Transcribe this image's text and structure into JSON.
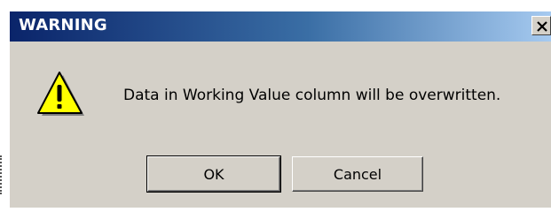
{
  "dialog": {
    "title": "WARNING",
    "message": "Data in Working Value column will be overwritten.",
    "icon": "warning-icon",
    "close_icon": "close-icon",
    "buttons": {
      "ok_label": "OK",
      "cancel_label": "Cancel"
    },
    "colors": {
      "titlebar_start": "#0a246a",
      "titlebar_end": "#a6caf0",
      "dialog_bg": "#d4d0c8",
      "warning_yellow": "#ffff00"
    }
  }
}
